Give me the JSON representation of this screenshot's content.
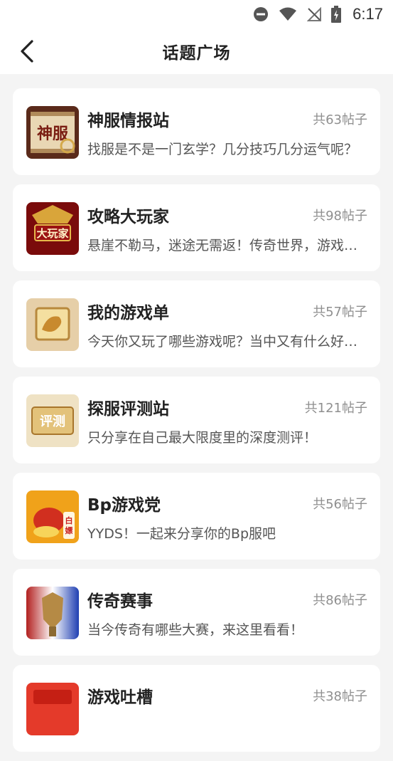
{
  "status_bar": {
    "time": "6:17"
  },
  "header": {
    "title": "话题广场"
  },
  "topics": [
    {
      "title": "神服情报站",
      "count": "共63帖子",
      "desc": "找服是不是一门玄学？几分技巧几分运气呢？"
    },
    {
      "title": "攻略大玩家",
      "count": "共98帖子",
      "desc": "悬崖不勒马，迷途无需返！传奇世界，游戏攻略"
    },
    {
      "title": "我的游戏单",
      "count": "共57帖子",
      "desc": "今天你又玩了哪些游戏呢？当中又有什么好玩的"
    },
    {
      "title": "探服评测站",
      "count": "共121帖子",
      "desc": "只分享在自己最大限度里的深度测评！"
    },
    {
      "title": "Bp游戏党",
      "count": "共56帖子",
      "desc": "YYDS！一起来分享你的Bp服吧"
    },
    {
      "title": "传奇赛事",
      "count": "共86帖子",
      "desc": "当今传奇有哪些大赛，来这里看看！"
    },
    {
      "title": "游戏吐槽",
      "count": "共38帖子",
      "desc": ""
    }
  ],
  "icons": {
    "back": "chevron-left-icon",
    "status": [
      "do-not-disturb-icon",
      "wifi-icon",
      "no-signal-icon",
      "battery-charging-icon"
    ]
  }
}
